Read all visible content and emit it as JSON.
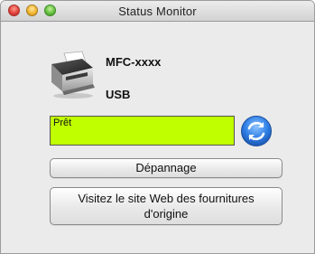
{
  "window": {
    "title": "Status Monitor"
  },
  "device": {
    "icon": "printer-icon",
    "model": "MFC-xxxx",
    "connection": "USB"
  },
  "status": {
    "text": "Prêt",
    "color": "#c0ff00"
  },
  "refresh": {
    "icon": "refresh-icon",
    "color": "#2f7fe6"
  },
  "buttons": {
    "troubleshoot_label": "Dépannage",
    "supplies_label": "Visitez le site Web des fournitures\nd'origine"
  }
}
